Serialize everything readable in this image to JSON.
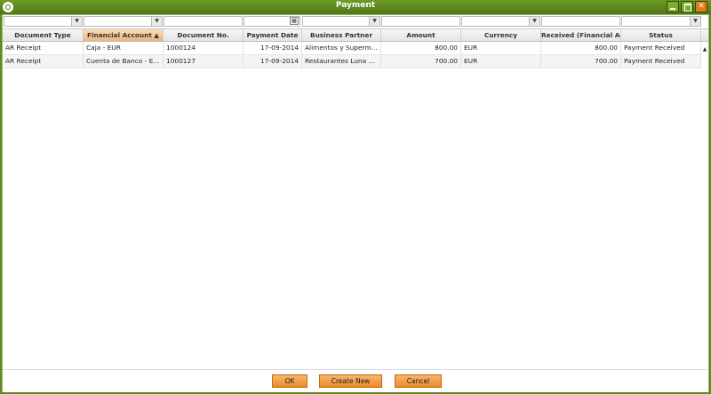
{
  "window": {
    "title": "Payment"
  },
  "grid": {
    "columns": [
      {
        "label": "Document Type",
        "sorted": false
      },
      {
        "label": "Financial Account ▲",
        "sorted": true
      },
      {
        "label": "Document No.",
        "sorted": false
      },
      {
        "label": "Payment Date",
        "sorted": false
      },
      {
        "label": "Business Partner",
        "sorted": false
      },
      {
        "label": "Amount",
        "sorted": false
      },
      {
        "label": "Currency",
        "sorted": false
      },
      {
        "label": "Received (Financial Ac...",
        "sorted": false
      },
      {
        "label": "Status",
        "sorted": false
      }
    ],
    "rows": [
      {
        "doc_type": "AR Receipt",
        "fin_account": "Caja - EUR",
        "doc_no": "1000124",
        "payment_date": "17-09-2014",
        "business_partner": "Alimentos y Superm...",
        "amount": "800.00",
        "currency": "EUR",
        "received": "800.00",
        "status": "Payment Received"
      },
      {
        "doc_type": "AR Receipt",
        "fin_account": "Cuenta de Banco - E...",
        "doc_no": "1000127",
        "payment_date": "17-09-2014",
        "business_partner": "Restaurantes Luna L...",
        "amount": "700.00",
        "currency": "EUR",
        "received": "700.00",
        "status": "Payment Received"
      }
    ]
  },
  "buttons": {
    "ok": "OK",
    "create_new": "Create New",
    "cancel": "Cancel"
  },
  "icons": {
    "app": "openbravo-logo-icon",
    "minimize": "minimize-icon",
    "maximize": "maximize-icon",
    "close": "close-icon"
  },
  "colors": {
    "titlebar": "#5f8a1e",
    "accent_button": "#ec8b2e",
    "sorted_header": "#f2b27a"
  }
}
